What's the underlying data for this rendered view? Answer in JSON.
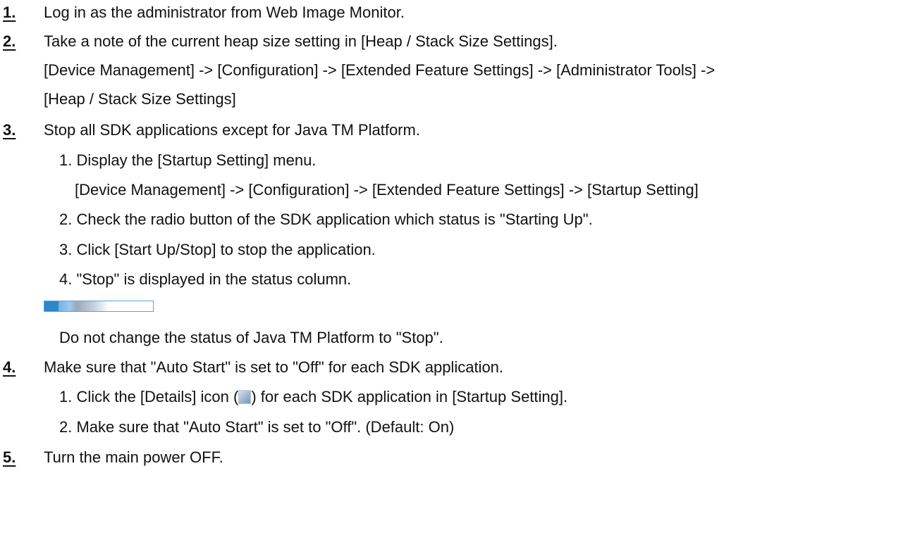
{
  "steps": [
    {
      "number": "1.",
      "text": "Log in as the administrator from Web Image Monitor."
    },
    {
      "number": "2.",
      "text": "Take a note of the current heap size setting in [Heap / Stack Size Settings].",
      "path_line1": "[Device Management] -> [Configuration] -> [Extended Feature Settings] -> [Administrator Tools] ->",
      "path_line2": "[Heap / Stack Size Settings]"
    },
    {
      "number": "3.",
      "text": "Stop all SDK applications except for Java TM Platform.",
      "sub": [
        "1. Display the [Startup Setting] menu.",
        "2. Check the radio button of the SDK application which status is \"Starting Up\".",
        "3. Click [Start Up/Stop] to stop the application.",
        "4. \"Stop\" is displayed in the status column."
      ],
      "sub1_path": "[Device Management] -> [Configuration] -> [Extended Feature Settings] -> [Startup Setting]",
      "note": "Do not change the status of Java TM Platform to \"Stop\"."
    },
    {
      "number": "4.",
      "text": "Make sure that \"Auto Start\" is set to \"Off\" for each SDK application.",
      "sub1_before": "1. Click the [Details] icon (",
      "sub1_after": ") for each SDK application in [Startup Setting].",
      "sub2": "2. Make sure that \"Auto Start\" is set to \"Off\". (Default: On)"
    },
    {
      "number": "5.",
      "text": "Turn the main power OFF."
    }
  ]
}
